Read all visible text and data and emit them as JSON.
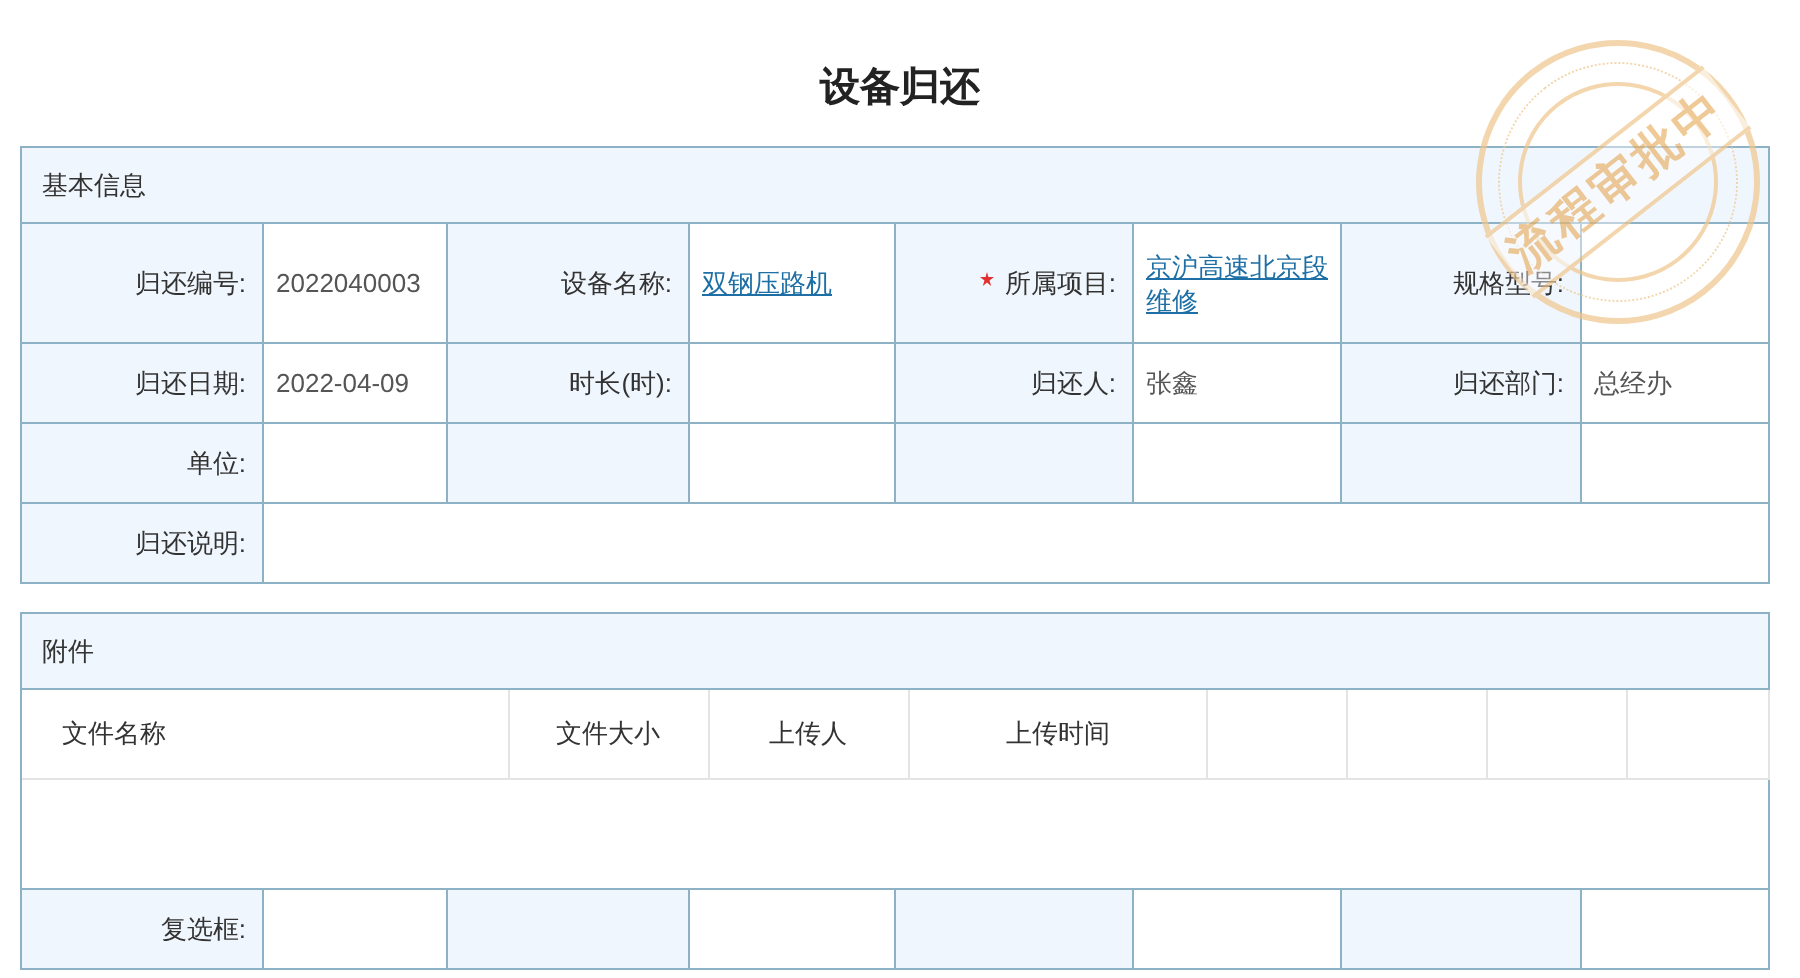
{
  "title": "设备归还",
  "stamp": {
    "text": "流程审批中"
  },
  "basic_info": {
    "title": "基本信息",
    "rows": [
      [
        {
          "kind": "label",
          "text": "归还编号:"
        },
        {
          "kind": "value",
          "text": "2022040003"
        },
        {
          "kind": "label",
          "text": "设备名称:"
        },
        {
          "kind": "link",
          "text": "双钢压路机"
        },
        {
          "kind": "label",
          "text": "所属项目:",
          "required": true
        },
        {
          "kind": "link",
          "text": "京沪高速北京段维修"
        },
        {
          "kind": "label",
          "text": "规格型号:"
        },
        {
          "kind": "blank"
        }
      ],
      [
        {
          "kind": "label",
          "text": "归还日期:"
        },
        {
          "kind": "value",
          "text": "2022-04-09"
        },
        {
          "kind": "label",
          "text": "时长(时):"
        },
        {
          "kind": "blank"
        },
        {
          "kind": "label",
          "text": "归还人:"
        },
        {
          "kind": "value",
          "text": "张鑫"
        },
        {
          "kind": "label",
          "text": "归还部门:"
        },
        {
          "kind": "value",
          "text": "总经办"
        }
      ],
      [
        {
          "kind": "label",
          "text": "单位:"
        },
        {
          "kind": "blank"
        },
        {
          "kind": "blank_label"
        },
        {
          "kind": "blank"
        },
        {
          "kind": "blank_label"
        },
        {
          "kind": "blank"
        },
        {
          "kind": "blank_label"
        },
        {
          "kind": "blank"
        }
      ],
      [
        {
          "kind": "label",
          "text": "归还说明:"
        },
        {
          "kind": "wide"
        }
      ]
    ]
  },
  "attachments": {
    "title": "附件",
    "columns": [
      "文件名称",
      "文件大小",
      "上传人",
      "上传时间"
    ],
    "checkbox_row": {
      "label": "复选框:"
    }
  }
}
